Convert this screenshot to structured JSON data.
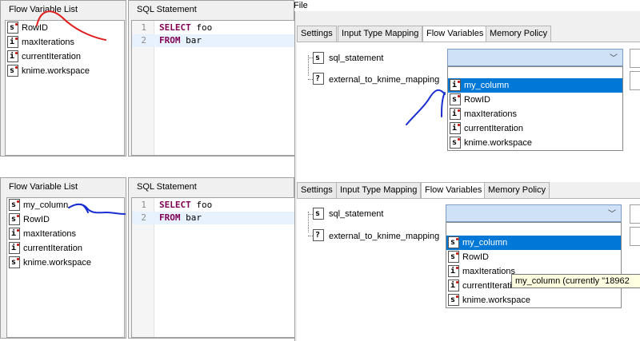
{
  "top": {
    "flow_variable_list": {
      "title": "Flow Variable List",
      "items": [
        {
          "type": "s",
          "label": "RowID"
        },
        {
          "type": "i",
          "label": "maxIterations"
        },
        {
          "type": "i",
          "label": "currentIteration"
        },
        {
          "type": "s",
          "label": "knime.workspace"
        }
      ]
    },
    "sql_statement": {
      "title": "SQL Statement",
      "lines": [
        {
          "num": "1",
          "kw": "SELECT",
          "rest": " foo"
        },
        {
          "num": "2",
          "kw": "FROM",
          "rest": " bar"
        }
      ]
    },
    "file_menu": "File",
    "tabs": [
      "Settings",
      "Input Type Mapping",
      "Flow Variables",
      "Memory Policy"
    ],
    "active_tab": "Flow Variables",
    "rows": [
      {
        "type": "s",
        "label": "sql_statement"
      },
      {
        "type": "?",
        "label": "external_to_knime_mapping"
      }
    ],
    "dropdown": {
      "items": [
        {
          "type": "i",
          "label": "my_column",
          "selected": true
        },
        {
          "type": "s",
          "label": "RowID"
        },
        {
          "type": "i",
          "label": "maxIterations"
        },
        {
          "type": "i",
          "label": "currentIteration"
        },
        {
          "type": "s",
          "label": "knime.workspace"
        }
      ]
    }
  },
  "bottom": {
    "flow_variable_list": {
      "title": "Flow Variable List",
      "items": [
        {
          "type": "s",
          "label": "my_column"
        },
        {
          "type": "s",
          "label": "RowID"
        },
        {
          "type": "i",
          "label": "maxIterations"
        },
        {
          "type": "i",
          "label": "currentIteration"
        },
        {
          "type": "s",
          "label": "knime.workspace"
        }
      ]
    },
    "sql_statement": {
      "title": "SQL Statement",
      "lines": [
        {
          "num": "1",
          "kw": "SELECT",
          "rest": " foo"
        },
        {
          "num": "2",
          "kw": "FROM",
          "rest": " bar"
        }
      ]
    },
    "tabs": [
      "Settings",
      "Input Type Mapping",
      "Flow Variables",
      "Memory Policy"
    ],
    "active_tab": "Flow Variables",
    "rows": [
      {
        "type": "s",
        "label": "sql_statement"
      },
      {
        "type": "?",
        "label": "external_to_knime_mapping"
      }
    ],
    "dropdown": {
      "items": [
        {
          "type": "s",
          "label": "my_column",
          "selected": true
        },
        {
          "type": "s",
          "label": "RowID"
        },
        {
          "type": "i",
          "label": "maxIterations"
        },
        {
          "type": "i",
          "label": "currentIteration"
        },
        {
          "type": "s",
          "label": "knime.workspace"
        }
      ]
    },
    "tooltip": "my_column (currently \"18962"
  },
  "annotation_colors": {
    "red": "#e02020",
    "blue": "#1a2fd0"
  },
  "colors": {
    "selection": "#0078d7",
    "dropdown_fill": "#cfe1f7",
    "keyword": "#7f0055"
  }
}
